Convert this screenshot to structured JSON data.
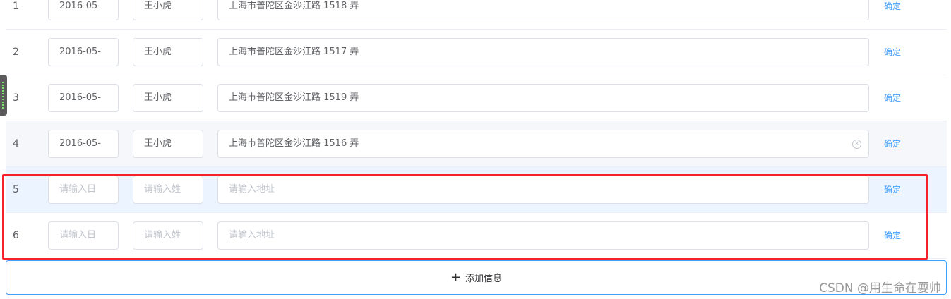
{
  "rows": [
    {
      "index": "1",
      "date": "2016-05-",
      "date_placeholder": "",
      "name": "王小虎",
      "name_placeholder": "",
      "address": "上海市普陀区金沙江路 1518 弄",
      "address_placeholder": "",
      "confirm": "确定"
    },
    {
      "index": "2",
      "date": "2016-05-",
      "date_placeholder": "",
      "name": "王小虎",
      "name_placeholder": "",
      "address": "上海市普陀区金沙江路 1517 弄",
      "address_placeholder": "",
      "confirm": "确定"
    },
    {
      "index": "3",
      "date": "2016-05-",
      "date_placeholder": "",
      "name": "王小虎",
      "name_placeholder": "",
      "address": "上海市普陀区金沙江路 1519 弄",
      "address_placeholder": "",
      "confirm": "确定"
    },
    {
      "index": "4",
      "date": "2016-05-",
      "date_placeholder": "",
      "name": "王小虎",
      "name_placeholder": "",
      "address": "上海市普陀区金沙江路 1516 弄",
      "address_placeholder": "",
      "confirm": "确定"
    },
    {
      "index": "5",
      "date": "",
      "date_placeholder": "请输入日",
      "name": "",
      "name_placeholder": "请输入姓",
      "address": "",
      "address_placeholder": "请输入地址",
      "confirm": "确定"
    },
    {
      "index": "6",
      "date": "",
      "date_placeholder": "请输入日",
      "name": "",
      "name_placeholder": "请输入姓",
      "address": "",
      "address_placeholder": "请输入地址",
      "confirm": "确定"
    }
  ],
  "add_button": {
    "icon": "plus-icon",
    "label": "添加信息"
  },
  "watermark": "CSDN @用生命在耍帅",
  "colors": {
    "accent": "#409eff",
    "highlight_box": "#f5222d",
    "row_hover": "#f5f7fa",
    "row_selected": "#ecf5ff"
  }
}
